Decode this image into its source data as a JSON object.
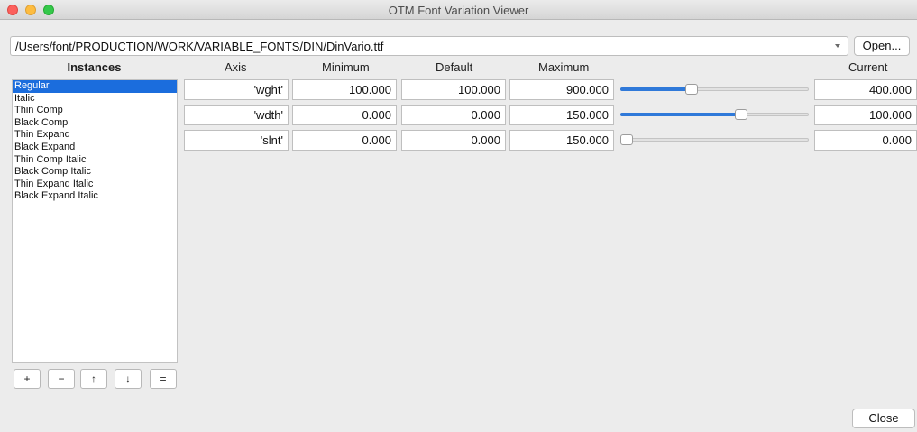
{
  "window": {
    "title": "OTM Font Variation Viewer"
  },
  "font_path": {
    "value": "/Users/font/PRODUCTION/WORK/VARIABLE_FONTS/DIN/DinVario.ttf"
  },
  "buttons": {
    "open": "Open...",
    "close": "Close",
    "list_add": "+",
    "list_remove": "−",
    "list_up": "↑",
    "list_down": "↓",
    "list_equal": "="
  },
  "instances": {
    "header": "Instances",
    "selected_index": 0,
    "items": [
      "Regular",
      "Italic",
      "Thin Comp",
      "Black Comp",
      "Thin Expand",
      "Black Expand",
      "Thin Comp Italic",
      "Black Comp Italic",
      "Thin Expand Italic",
      "Black Expand Italic"
    ]
  },
  "columns": {
    "axis": "Axis",
    "minimum": "Minimum",
    "default": "Default",
    "maximum": "Maximum",
    "current": "Current"
  },
  "axes": [
    {
      "tag": "'wght'",
      "minimum": "100.000",
      "default": "100.000",
      "maximum": "900.000",
      "current": "400.000",
      "slider_fraction": 0.375
    },
    {
      "tag": "'wdth'",
      "minimum": "0.000",
      "default": "0.000",
      "maximum": "150.000",
      "current": "100.000",
      "slider_fraction": 0.667
    },
    {
      "tag": "'slnt'",
      "minimum": "0.000",
      "default": "0.000",
      "maximum": "150.000",
      "current": "0.000",
      "slider_fraction": 0.0
    }
  ],
  "colors": {
    "selection": "#1b6ddd",
    "slider_fill": "#2f79d9",
    "traffic_close": "#fc605c",
    "traffic_minimize": "#fdbc40",
    "traffic_zoom": "#34c84a"
  }
}
